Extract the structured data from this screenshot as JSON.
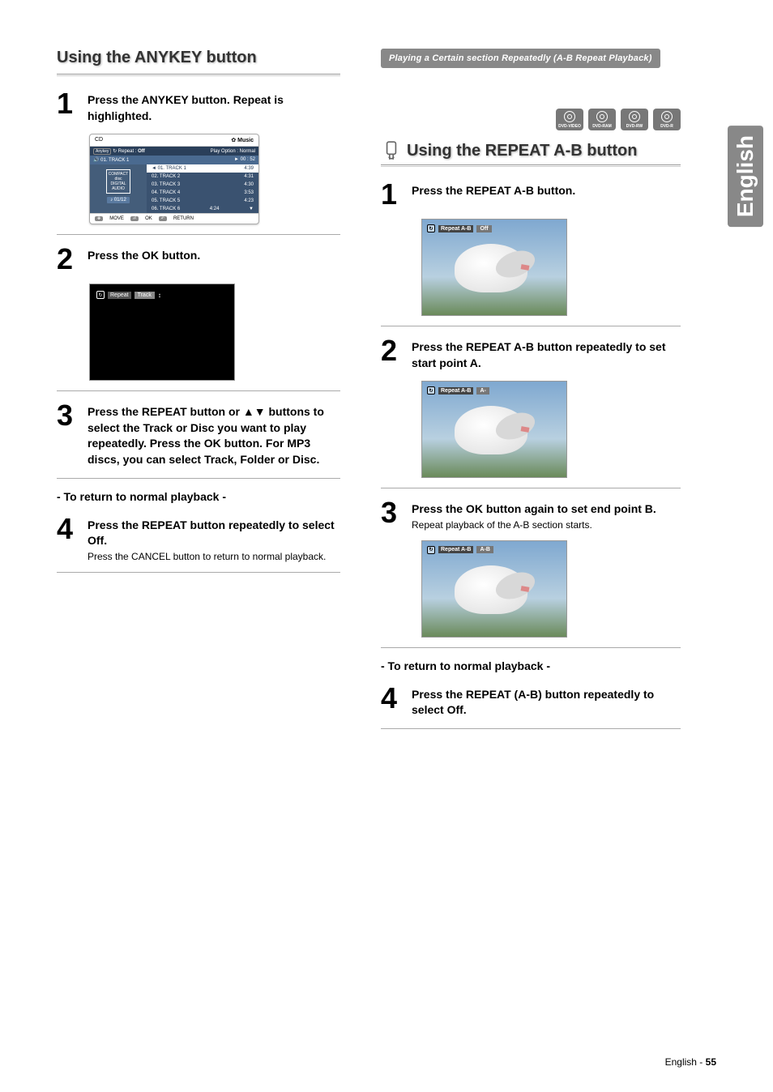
{
  "sideTab": "English",
  "footer": {
    "prefix": "English - ",
    "page": "55"
  },
  "left": {
    "title": "Using the ANYKEY button",
    "step1": {
      "text": "Press the ANYKEY button. Repeat is highlighted."
    },
    "osd": {
      "hdLeft": "CD",
      "hdRightIcon": "✿",
      "hdRight": "Music",
      "anykey": "Anykey",
      "repeat": "Repeat :",
      "repVal": "Off",
      "playOpt": "Play Option : Normal",
      "now": "01. TRACK 1",
      "time": "00 : 52",
      "badge": "01/12",
      "discLabel": "DIGITAL AUDIO",
      "tracks": [
        {
          "n": "01. TRACK 1",
          "t": "4:39"
        },
        {
          "n": "02. TRACK 2",
          "t": "4:31"
        },
        {
          "n": "03. TRACK 3",
          "t": "4:30"
        },
        {
          "n": "04. TRACK 4",
          "t": "3:53"
        },
        {
          "n": "05. TRACK 5",
          "t": "4:23"
        },
        {
          "n": "06. TRACK 6",
          "t": "4:24"
        }
      ],
      "ftMove": "MOVE",
      "ftOk": "OK",
      "ftReturn": "RETURN"
    },
    "step2": {
      "text": "Press the OK button."
    },
    "slim": {
      "lab": "Repeat",
      "val": "Track",
      "arr": "↕"
    },
    "step3": {
      "text": "Press the REPEAT button or ▲▼ buttons to select the Track or Disc you want to play repeatedly. Press the OK button. For MP3 discs, you can select Track, Folder or Disc."
    },
    "subhead": "- To return to normal playback -",
    "step4": {
      "text": "Press the REPEAT button repeatedly to select Off.",
      "sub": "Press the CANCEL button to return to normal playback."
    }
  },
  "right": {
    "callout": "Playing a Certain section Repeatedly (A-B Repeat Playback)",
    "discs": [
      "DVD-VIDEO",
      "DVD-RAM",
      "DVD-RW",
      "DVD-R"
    ],
    "title": "Using the REPEAT A-B button",
    "step1": {
      "text": "Press the REPEAT A-B button."
    },
    "scr1": {
      "lab": "Repeat A-B",
      "val": "Off"
    },
    "step2": {
      "text": "Press the REPEAT A-B button repeatedly to set start point A."
    },
    "scr2": {
      "lab": "Repeat A-B",
      "val": "A-"
    },
    "step3": {
      "text": "Press the OK button again to set end point B.",
      "sub": "Repeat playback of the A-B section starts."
    },
    "scr3": {
      "lab": "Repeat A-B",
      "val": "A-B"
    },
    "subhead": "- To return to normal playback -",
    "step4": {
      "text": "Press the REPEAT (A-B) button repeatedly to select Off."
    }
  }
}
